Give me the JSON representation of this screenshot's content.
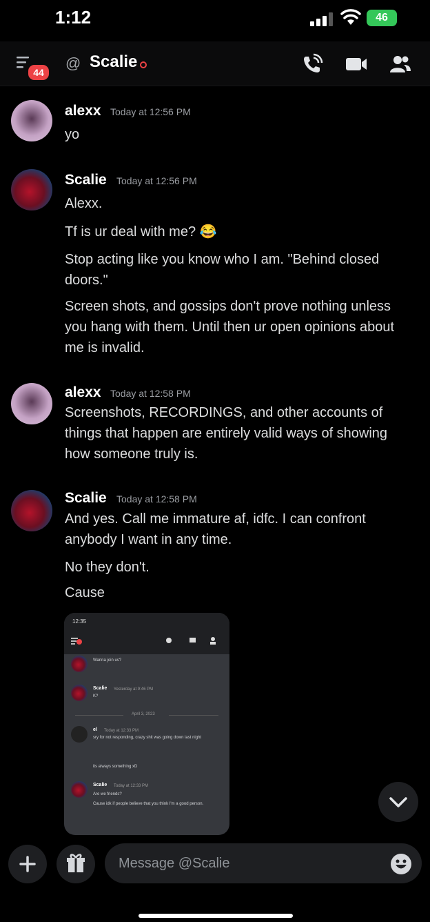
{
  "status_bar": {
    "time": "1:12",
    "battery": "46"
  },
  "header": {
    "unread_count": "44",
    "at_symbol": "@",
    "title": "Scalie"
  },
  "messages": [
    {
      "username": "alexx",
      "timestamp": "Today at 12:56 PM",
      "lines": [
        "yo"
      ]
    },
    {
      "username": "Scalie",
      "timestamp": "Today at 12:56 PM",
      "lines": [
        "Alexx.",
        "Tf is ur deal with me? 😂",
        "Stop acting like you know who I am. \"Behind closed doors.\"",
        "Screen shots, and gossips don't prove nothing unless you hang with them. Until then ur open opinions about me is invalid."
      ]
    },
    {
      "username": "alexx",
      "timestamp": "Today at 12:58 PM",
      "lines": [
        "Screenshots, RECORDINGS, and other accounts of things that happen are entirely valid ways of showing how someone truly is."
      ]
    },
    {
      "username": "Scalie",
      "timestamp": "Today at 12:58 PM",
      "lines": [
        "And yes. Call me immature af, idfc. I can confront anybody I want in any time.",
        "No they don't.",
        "Cause"
      ]
    }
  ],
  "attachment": {
    "status_time": "12:35",
    "rows": [
      {
        "name": "",
        "text": "Wanna join us?"
      },
      {
        "name": "Scalie",
        "time": "Yesterday at 9:46 PM",
        "text": "K?"
      },
      {
        "divider": "April 3, 2023"
      },
      {
        "name": "el",
        "time": "Today at 12:33 PM",
        "text": "sry for not responding, crazy shit was going down last night"
      },
      {
        "text": "its always something xD"
      },
      {
        "name": "Scalie",
        "time": "Today at 12:33 PM",
        "text": "Are we friends?"
      },
      {
        "text": "Cause idk if people believe that you think I'm a good person."
      }
    ]
  },
  "composer": {
    "placeholder": "Message @Scalie"
  },
  "colors": {
    "background": "#000000",
    "dnd": "#ed4245",
    "badge": "#ed4245",
    "battery": "#34c759"
  }
}
